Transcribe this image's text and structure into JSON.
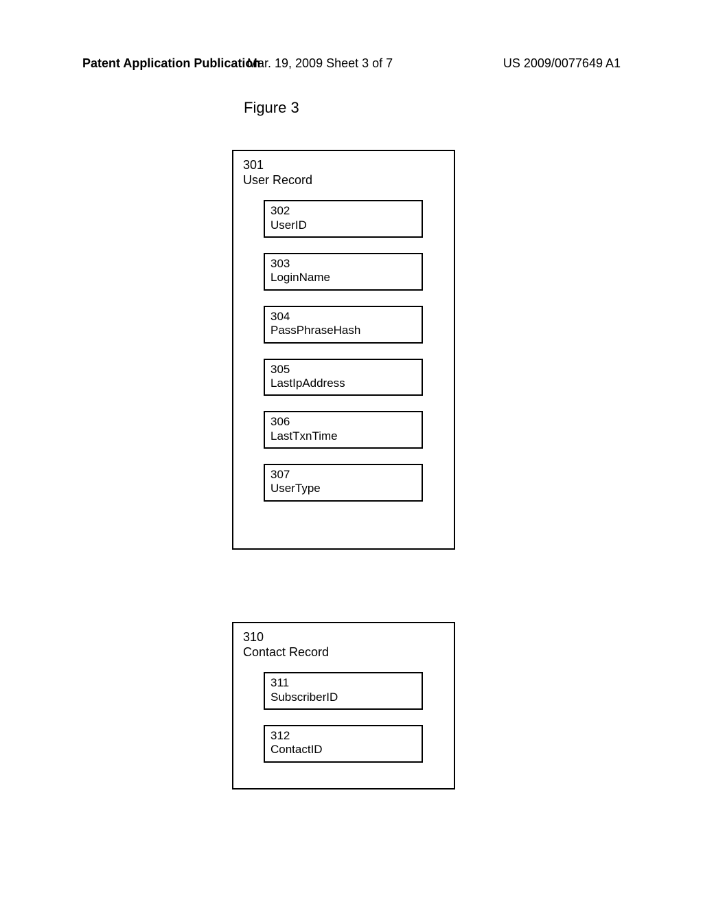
{
  "header": {
    "left": "Patent Application Publication",
    "center": "Mar. 19, 2009  Sheet 3 of 7",
    "right": "US 2009/0077649 A1"
  },
  "figure_label": "Figure 3",
  "user_record": {
    "ref": "301",
    "name": "User Record",
    "fields": [
      {
        "ref": "302",
        "name": "UserID"
      },
      {
        "ref": "303",
        "name": "LoginName"
      },
      {
        "ref": "304",
        "name": "PassPhraseHash"
      },
      {
        "ref": "305",
        "name": "LastIpAddress"
      },
      {
        "ref": "306",
        "name": "LastTxnTime"
      },
      {
        "ref": "307",
        "name": "UserType"
      }
    ]
  },
  "contact_record": {
    "ref": "310",
    "name": "Contact Record",
    "fields": [
      {
        "ref": "311",
        "name": "SubscriberID"
      },
      {
        "ref": "312",
        "name": "ContactID"
      }
    ]
  }
}
